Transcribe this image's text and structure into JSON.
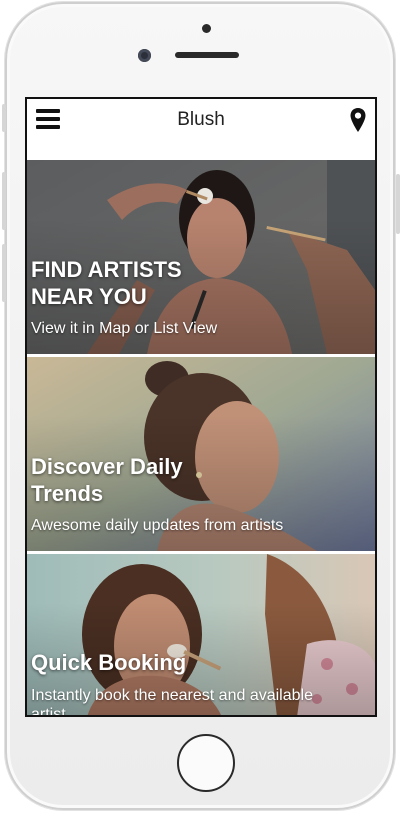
{
  "app": {
    "title": "Blush"
  },
  "icons": {
    "menu": "menu-icon",
    "location": "location-pin-icon"
  },
  "cards": [
    {
      "title_line1": "FIND ARTISTS",
      "title_line2": "NEAR YOU",
      "subtitle": "View it in Map or List View"
    },
    {
      "title_line1": "Discover Daily",
      "title_line2": "Trends",
      "subtitle": "Awesome daily updates from artists"
    },
    {
      "title_line1": "Quick Booking",
      "subtitle_line1": "Instantly book the nearest and available",
      "subtitle_line2": "artist"
    }
  ],
  "colors": {
    "text_on_image": "#ffffff",
    "appbar_bg": "#ffffff",
    "icon": "#111111"
  }
}
